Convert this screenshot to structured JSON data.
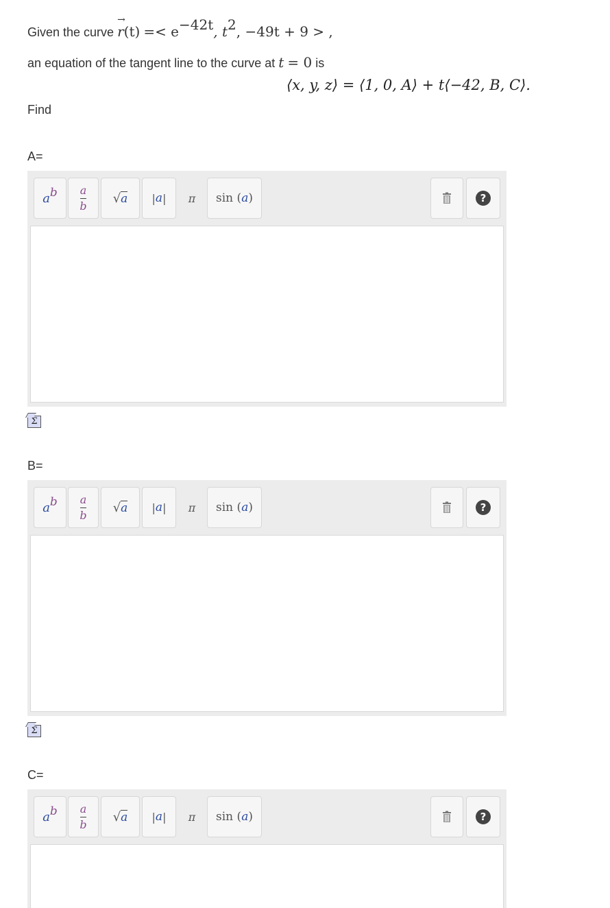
{
  "problem": {
    "given_prefix": "Given the curve",
    "curve_r": "r",
    "curve_t": "(t)",
    "curve_open": "=< e",
    "curve_exp": "−42t",
    "curve_mid": ", t",
    "curve_sq": "2",
    "curve_tail": ", −49t + 9 > ,",
    "line2_prefix": "an equation of the tangent line to the curve at",
    "line2_t": "t",
    "line2_eq": "= 0",
    "line2_suffix": "is",
    "tangent_eq": "⟨x, y, z⟩ = ⟨1, 0, A⟩ + t⟨−42, B, C⟩.",
    "find": "Find"
  },
  "answers": [
    {
      "label": "A="
    },
    {
      "label": "B="
    },
    {
      "label": "C="
    }
  ],
  "toolbar": {
    "power_base": "a",
    "power_exp": "b",
    "frac_num": "a",
    "frac_den": "b",
    "sqrt_symbol": "√",
    "sqrt_arg": "a",
    "abs_left": "|",
    "abs_arg": "a",
    "abs_right": "|",
    "pi": "π",
    "sin_text": "sin",
    "sin_open": " (",
    "sin_arg": "a",
    "sin_close": ")",
    "help": "?"
  },
  "sigma_symbol": "Σ"
}
